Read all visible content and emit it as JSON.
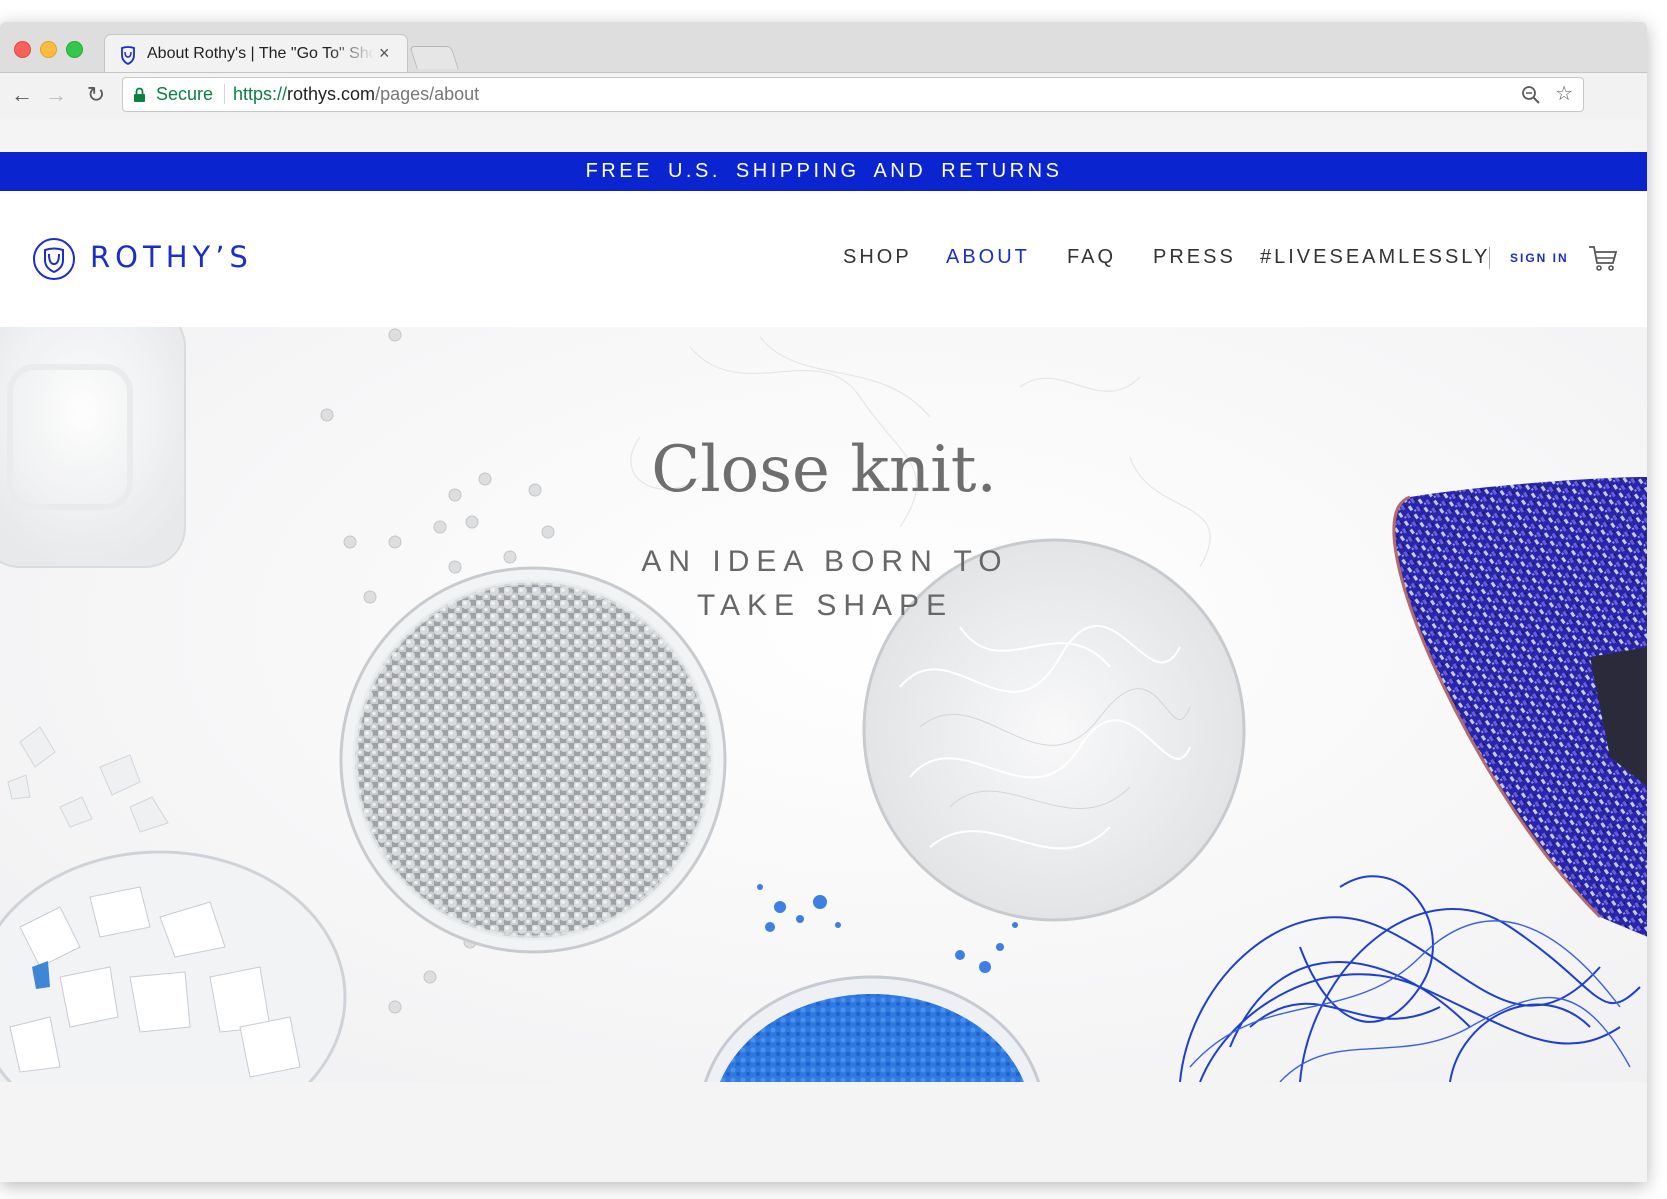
{
  "browser": {
    "tab_title": "About Rothy's | The \"Go To\" Shoe",
    "tab_close": "×",
    "security_label": "Secure",
    "url_scheme": "https://",
    "url_host": "rothys.com",
    "url_path": "/pages/about",
    "back_icon": "←",
    "forward_icon": "→",
    "reload_icon": "↻",
    "bookmark_icon": "☆"
  },
  "promo_bar": {
    "text": "FREE U.S. SHIPPING AND RETURNS",
    "background": "#0a24cf"
  },
  "header": {
    "logo_text": "ROTHY’S",
    "brand_color": "#1a2ec8",
    "nav": [
      {
        "label": "SHOP",
        "active": false
      },
      {
        "label": "ABOUT",
        "active": true
      },
      {
        "label": "FAQ",
        "active": false
      },
      {
        "label": "PRESS",
        "active": false
      },
      {
        "label": "#LIVESEAMLESSLY",
        "active": false
      }
    ],
    "sign_in": "SIGN IN",
    "cart_icon": "cart-icon"
  },
  "hero": {
    "title": "Close knit.",
    "subtitle": "AN IDEA BORN TO TAKE SHAPE"
  }
}
